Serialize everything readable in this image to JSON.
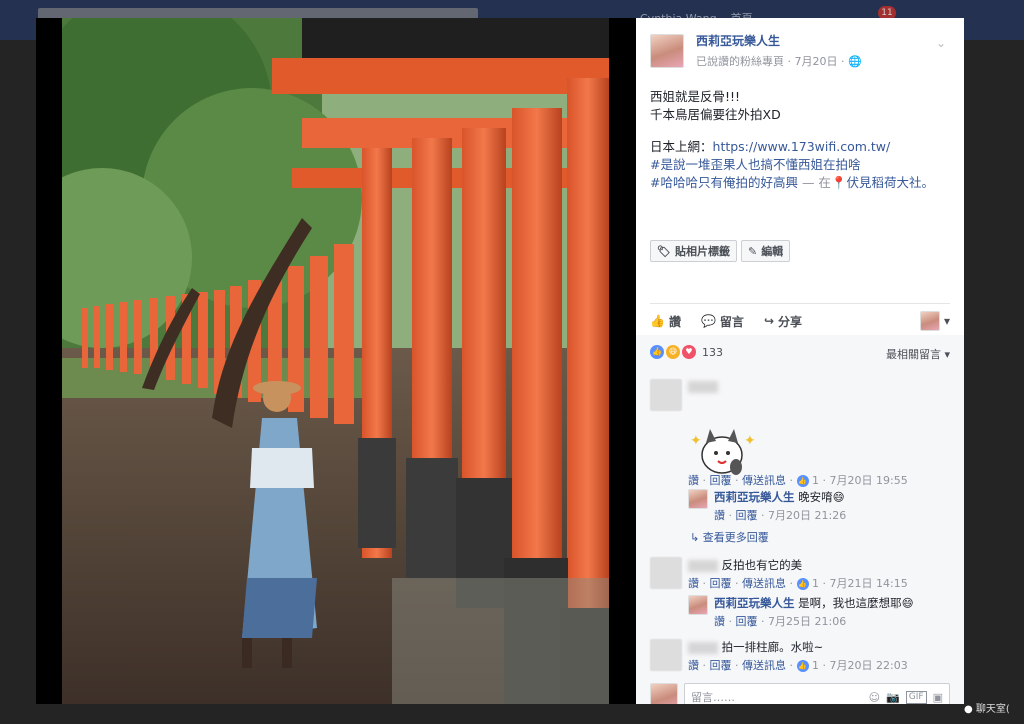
{
  "topbar": {
    "user": "Cynthia Wang",
    "home": "首頁",
    "notif_count": "11"
  },
  "post": {
    "page_name": "西莉亞玩樂人生",
    "visibility": "已說讚的粉絲專頁",
    "date": "7月20日",
    "text_lines": [
      "西姐就是反骨!!!",
      "千本鳥居偏要往外拍XD",
      "",
      "日本上網：",
      "#是說一堆歪果人也搞不懂西姐在拍啥",
      "#哈哈哈只有俺拍的好高興"
    ],
    "url": "https://www.173wifi.com.tw/",
    "location_prefix": " — 在",
    "location": "伏見稻荷大社。"
  },
  "tag_buttons": {
    "tag": "貼相片標籤",
    "edit": "編輯"
  },
  "actions": {
    "like": "讚",
    "comment": "留言",
    "share": "分享"
  },
  "reactions": {
    "count": "133",
    "sort": "最相關留言"
  },
  "comments": [
    {
      "text": "",
      "reply": "回覆",
      "send": "傳送訊息",
      "likes": "1",
      "time": "7月20日 19:55"
    },
    {
      "author": "西莉亞玩樂人生",
      "text": "晚安唷😄",
      "reply": "回覆",
      "time": "7月20日 21:26"
    },
    {
      "more": "查看更多回覆"
    },
    {
      "text": "反拍也有它的美",
      "reply": "回覆",
      "send": "傳送訊息",
      "likes": "1",
      "time": "7月21日 14:15"
    },
    {
      "author": "西莉亞玩樂人生",
      "text": "是啊，我也這麼想耶😄",
      "reply": "回覆",
      "time": "7月25日 21:06"
    },
    {
      "text": "拍一排柱廊。水啦~",
      "reply": "回覆",
      "send": "傳送訊息",
      "likes": "1",
      "time": "7月20日 22:03"
    }
  ],
  "comment_input": {
    "placeholder": "留言……"
  },
  "bottom_chat": "聊天室(",
  "icons": [
    "search-icon",
    "like-icon",
    "comment-icon",
    "share-icon",
    "globe-icon",
    "location-pin-icon",
    "tag-icon",
    "edit-icon",
    "smiley-icon",
    "camera-icon",
    "gif-icon",
    "sticker-icon",
    "chevron-down-icon"
  ]
}
